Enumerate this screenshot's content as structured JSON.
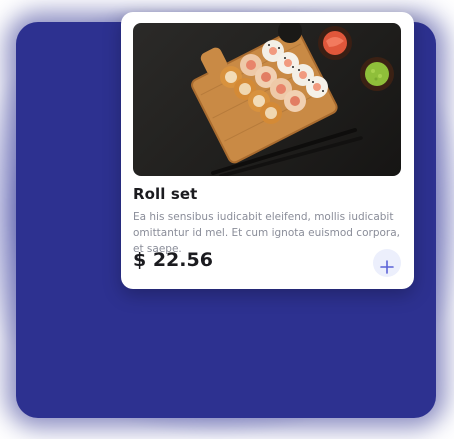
{
  "product": {
    "image_alt": "sushi-roll-board-photo",
    "name": "Roll set",
    "description": "Ea his sensibus iudicabit eleifend, mollis iudicabit omittantur id mel. Et cum ignota euismod corpora, et saepe.",
    "price": "$ 22.56"
  },
  "actions": {
    "add_icon": "plus-icon"
  },
  "colors": {
    "backdrop": "#2d3190",
    "card": "#ffffff",
    "add_button_bg": "#eceffc",
    "add_icon": "#5b62d6",
    "description_text": "#8a8d99"
  }
}
